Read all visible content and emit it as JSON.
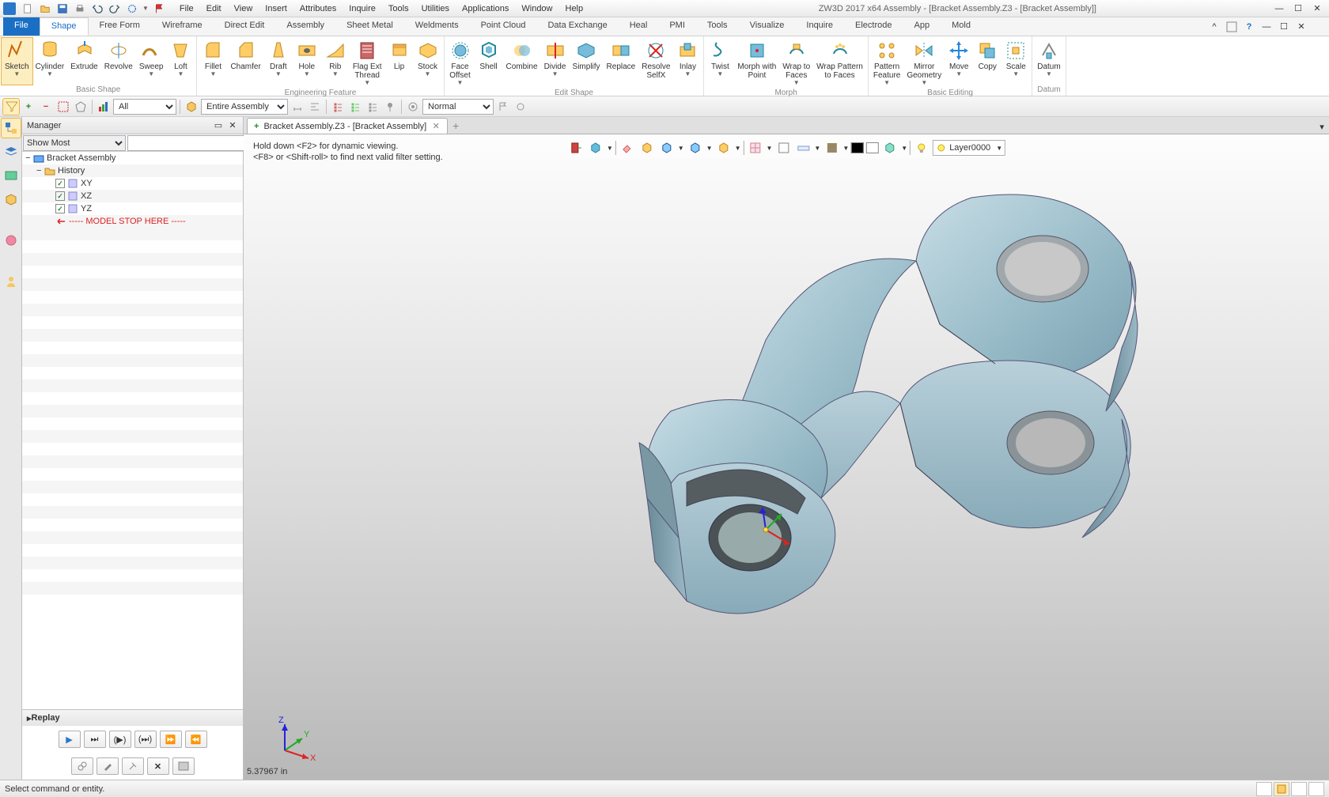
{
  "title": "ZW3D 2017  x64     Assembly - [Bracket Assembly.Z3 - [Bracket Assembly]]",
  "menus": [
    "File",
    "Edit",
    "View",
    "Insert",
    "Attributes",
    "Inquire",
    "Tools",
    "Utilities",
    "Applications",
    "Window",
    "Help"
  ],
  "ribbon_tabs": [
    "File",
    "Shape",
    "Free Form",
    "Wireframe",
    "Direct Edit",
    "Assembly",
    "Sheet Metal",
    "Weldments",
    "Point Cloud",
    "Data Exchange",
    "Heal",
    "PMI",
    "Tools",
    "Visualize",
    "Inquire",
    "Electrode",
    "App",
    "Mold"
  ],
  "active_tab": "Shape",
  "ribbon_groups": [
    {
      "label": "Basic Shape",
      "buttons": [
        {
          "name": "sketch",
          "label": "Sketch",
          "drop": true,
          "active": true
        },
        {
          "name": "cylinder",
          "label": "Cylinder",
          "drop": true
        },
        {
          "name": "extrude",
          "label": "Extrude"
        },
        {
          "name": "revolve",
          "label": "Revolve"
        },
        {
          "name": "sweep",
          "label": "Sweep",
          "drop": true
        },
        {
          "name": "loft",
          "label": "Loft",
          "drop": true
        }
      ]
    },
    {
      "label": "Engineering Feature",
      "buttons": [
        {
          "name": "fillet",
          "label": "Fillet",
          "drop": true
        },
        {
          "name": "chamfer",
          "label": "Chamfer"
        },
        {
          "name": "draft",
          "label": "Draft",
          "drop": true
        },
        {
          "name": "hole",
          "label": "Hole",
          "drop": true
        },
        {
          "name": "rib",
          "label": "Rib",
          "drop": true
        },
        {
          "name": "flagext",
          "label": "Flag Ext\nThread",
          "drop": true
        },
        {
          "name": "lip",
          "label": "Lip"
        },
        {
          "name": "stock",
          "label": "Stock",
          "drop": true
        }
      ]
    },
    {
      "label": "Edit Shape",
      "buttons": [
        {
          "name": "faceoffset",
          "label": "Face\nOffset",
          "drop": true
        },
        {
          "name": "shell",
          "label": "Shell"
        },
        {
          "name": "combine",
          "label": "Combine"
        },
        {
          "name": "divide",
          "label": "Divide",
          "drop": true
        },
        {
          "name": "simplify",
          "label": "Simplify"
        },
        {
          "name": "replace",
          "label": "Replace"
        },
        {
          "name": "resolve",
          "label": "Resolve\nSelfX"
        },
        {
          "name": "inlay",
          "label": "Inlay",
          "drop": true
        }
      ]
    },
    {
      "label": "Morph",
      "buttons": [
        {
          "name": "twist",
          "label": "Twist",
          "drop": true
        },
        {
          "name": "morphpoint",
          "label": "Morph with\nPoint"
        },
        {
          "name": "wrapto",
          "label": "Wrap to\nFaces",
          "drop": true
        },
        {
          "name": "wrappattern",
          "label": "Wrap Pattern\nto Faces"
        }
      ]
    },
    {
      "label": "Basic Editing",
      "buttons": [
        {
          "name": "pattern",
          "label": "Pattern\nFeature",
          "drop": true
        },
        {
          "name": "mirror",
          "label": "Mirror\nGeometry",
          "drop": true
        },
        {
          "name": "move",
          "label": "Move",
          "drop": true
        },
        {
          "name": "copy",
          "label": "Copy"
        },
        {
          "name": "scale",
          "label": "Scale",
          "drop": true
        }
      ]
    },
    {
      "label": "Datum",
      "buttons": [
        {
          "name": "datum",
          "label": "Datum",
          "drop": true
        }
      ]
    }
  ],
  "filter_all": "All",
  "filter_assembly": "Entire Assembly",
  "filter_normal": "Normal",
  "manager_title": "Manager",
  "show_option": "Show Most",
  "tree": {
    "root": "Bracket Assembly",
    "history": "History",
    "planes": [
      "XY",
      "XZ",
      "YZ"
    ],
    "stop": "----- MODEL STOP HERE -----"
  },
  "replay_label": "Replay",
  "doc_tab": "Bracket Assembly.Z3 - [Bracket Assembly]",
  "hint1": "Hold down <F2> for dynamic viewing.",
  "hint2": "<F8> or <Shift-roll> to find next valid filter setting.",
  "layer": "Layer0000",
  "measurement": "5.37967 in",
  "status": "Select command or entity."
}
